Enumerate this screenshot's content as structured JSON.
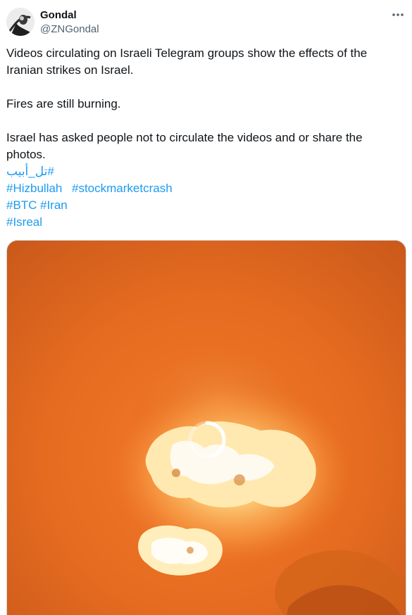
{
  "author": {
    "display_name": "Gondal",
    "handle": "@ZNGondal",
    "avatar_icon": "avatar-photo"
  },
  "tweet": {
    "line1": "Videos circulating on Israeli Telegram groups show the effects of the",
    "line2": "Iranian strikes on Israel.",
    "line3": "Fires are still burning.",
    "line4": "Israel has asked people not to circulate the videos and or share the",
    "line5": "photos.",
    "hashtags": {
      "tel_aviv": "#تل_أبيب",
      "hizbullah": "#Hizbullah",
      "stockmarketcrash": "#stockmarketcrash",
      "btc": "#BTC",
      "iran": "#Iran",
      "isreal": "#Isreal"
    }
  },
  "media": {
    "type": "video",
    "loading_icon": "loading-spinner-icon"
  },
  "actions": {
    "more_icon": "more-horizontal-icon"
  },
  "colors": {
    "text": "#0f1419",
    "secondary": "#536471",
    "link": "#1d9bf0",
    "border": "#cfd9de"
  }
}
